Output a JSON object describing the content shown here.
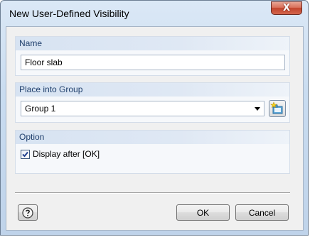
{
  "window": {
    "title": "New User-Defined Visibility",
    "close_glyph": "X"
  },
  "name_group": {
    "header": "Name",
    "value": "Floor slab"
  },
  "group_section": {
    "header": "Place into Group",
    "selected": "Group 1"
  },
  "option_section": {
    "header": "Option",
    "checkbox_label": "Display after [OK]",
    "checked": true
  },
  "buttons": {
    "ok": "OK",
    "cancel": "Cancel"
  },
  "icons": {
    "close": "close-icon",
    "help": "help-icon",
    "new_group": "new-group-icon",
    "dropdown": "chevron-down-icon",
    "check": "checkmark-icon"
  }
}
